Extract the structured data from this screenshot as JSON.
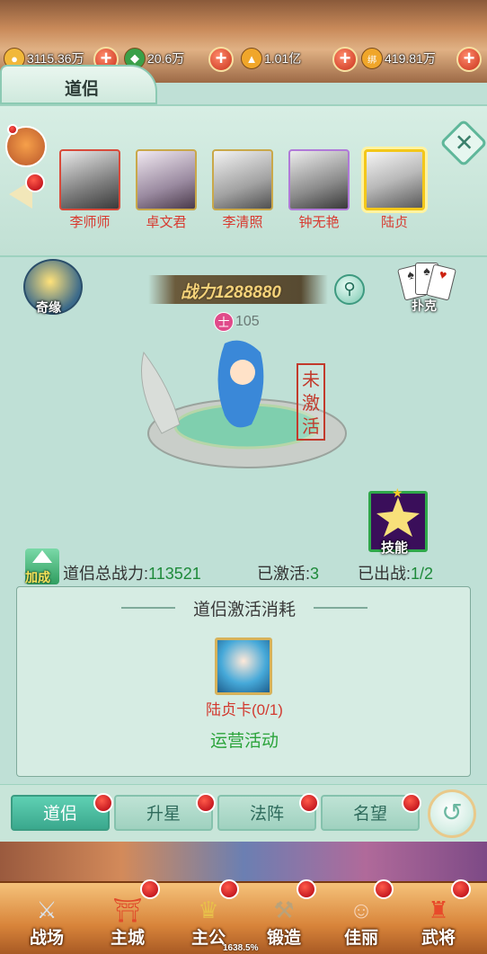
{
  "resources": [
    {
      "name": "coin",
      "icon": "coin-icon",
      "value": "3115.36万"
    },
    {
      "name": "jade",
      "icon": "jade-icon",
      "value": "20.6万"
    },
    {
      "name": "gold-ingot",
      "icon": "ingot-icon",
      "value": "1.01亿"
    },
    {
      "name": "bound-ingot",
      "icon": "bound-ingot-icon",
      "badge": "绑",
      "value": "419.81万"
    }
  ],
  "title_tab": "道侣",
  "companions": [
    {
      "name": "李师师",
      "selected": false
    },
    {
      "name": "卓文君",
      "selected": false
    },
    {
      "name": "李清照",
      "selected": false
    },
    {
      "name": "钟无艳",
      "selected": false
    },
    {
      "name": "陆贞",
      "selected": true
    }
  ],
  "qiyuan_label": "奇缘",
  "poker_label": "扑克",
  "power_label": "战力1288880",
  "level_badge": "士",
  "level_value": "105",
  "status_stamp": "未激活",
  "skill_label": "技能",
  "boost_label": "加成",
  "stats": {
    "total_power_label": "道侣总战力:",
    "total_power_value": "113521",
    "activated_label": "已激活:",
    "activated_value": "3",
    "deployed_label": "已出战:",
    "deployed_value": "1/2"
  },
  "activation_panel": {
    "title": "道侣激活消耗",
    "item_name": "陆贞卡",
    "item_count": "(0/1)",
    "event_link": "运营活动"
  },
  "tabs": [
    {
      "label": "道侣",
      "active": true
    },
    {
      "label": "升星",
      "active": false
    },
    {
      "label": "法阵",
      "active": false
    },
    {
      "label": "名望",
      "active": false
    }
  ],
  "bottom_nav": [
    {
      "label": "战场",
      "icon": "crossed-swords-icon"
    },
    {
      "label": "主城",
      "icon": "city-icon"
    },
    {
      "label": "主公",
      "icon": "lord-icon"
    },
    {
      "label": "锻造",
      "icon": "forge-icon"
    },
    {
      "label": "佳丽",
      "icon": "beauty-icon"
    },
    {
      "label": "武将",
      "icon": "general-icon"
    }
  ],
  "zoom_level": "1638.5%",
  "colors": {
    "accent": "#3aa88d",
    "alert_red": "#d83a30",
    "positive_green": "#1e8a3a",
    "gold": "#f3c71a"
  }
}
